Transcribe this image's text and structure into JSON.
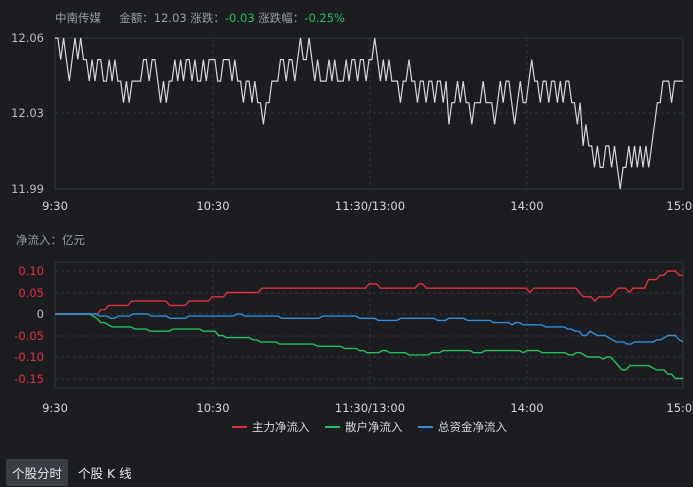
{
  "header": {
    "stock_name": "中南传媒",
    "amount_label": "金额：",
    "amount_value": "12.03",
    "change_label": "涨跌：",
    "change_value": "-0.03",
    "change_pct_label": "涨跌幅：",
    "change_pct_value": "-0.25%"
  },
  "colors": {
    "background": "#1b1d21",
    "price_line": "#d5d7da",
    "main_flow": "#e2313c",
    "retail_flow": "#21c25e",
    "total_flow": "#2f8fdc",
    "positive_tick": "#e2313c",
    "negative_tick": "#e2313c",
    "grid": "#33363c"
  },
  "unit_label": "净流入：亿元",
  "chart_data": [
    {
      "type": "line",
      "title": "",
      "x_ticks": [
        "9:30",
        "10:30",
        "11:30/13:00",
        "14:00",
        "15:00"
      ],
      "y_ticks": [
        "12.06",
        "12.03",
        "11.99"
      ],
      "ylim": [
        11.99,
        12.06
      ],
      "series": [
        {
          "values": [
            12.06,
            12.06,
            12.05,
            12.06,
            12.05,
            12.04,
            12.05,
            12.06,
            12.05,
            12.06,
            12.05,
            12.05,
            12.04,
            12.05,
            12.04,
            12.05,
            12.05,
            12.04,
            12.04,
            12.05,
            12.04,
            12.05,
            12.04,
            12.04,
            12.03,
            12.04,
            12.03,
            12.04,
            12.04,
            12.04,
            12.04,
            12.05,
            12.05,
            12.04,
            12.05,
            12.05,
            12.04,
            12.03,
            12.04,
            12.03,
            12.04,
            12.04,
            12.05,
            12.04,
            12.05,
            12.04,
            12.05,
            12.05,
            12.04,
            12.05,
            12.04,
            12.04,
            12.05,
            12.04,
            12.05,
            12.05,
            12.05,
            12.04,
            12.04,
            12.05,
            12.05,
            12.05,
            12.04,
            12.05,
            12.04,
            12.04,
            12.03,
            12.04,
            12.04,
            12.03,
            12.04,
            12.03,
            12.03,
            12.02,
            12.03,
            12.03,
            12.04,
            12.04,
            12.04,
            12.05,
            12.05,
            12.04,
            12.05,
            12.05,
            12.04,
            12.05,
            12.06,
            12.05,
            12.05,
            12.06,
            12.05,
            12.04,
            12.05,
            12.04,
            12.04,
            12.04,
            12.05,
            12.04,
            12.05,
            12.04,
            12.04,
            12.04,
            12.05,
            12.04,
            12.05,
            12.05,
            12.04,
            12.05,
            12.05,
            12.04,
            12.05,
            12.05,
            12.06,
            12.05,
            12.04,
            12.05,
            12.04,
            12.05,
            12.04,
            12.04,
            12.04,
            12.03,
            12.04,
            12.04,
            12.05,
            12.04,
            12.04,
            12.03,
            12.04,
            12.04,
            12.03,
            12.04,
            12.04,
            12.03,
            12.04,
            12.04,
            12.03,
            12.04,
            12.02,
            12.03,
            12.03,
            12.04,
            12.03,
            12.04,
            12.03,
            12.03,
            12.02,
            12.03,
            12.03,
            12.03,
            12.04,
            12.03,
            12.03,
            12.03,
            12.02,
            12.03,
            12.04,
            12.03,
            12.04,
            12.04,
            12.03,
            12.02,
            12.03,
            12.04,
            12.03,
            12.03,
            12.04,
            12.05,
            12.04,
            12.04,
            12.03,
            12.04,
            12.04,
            12.03,
            12.04,
            12.04,
            12.03,
            12.04,
            12.03,
            12.04,
            12.04,
            12.03,
            12.03,
            12.02,
            12.03,
            12.01,
            12.02,
            12.01,
            12.01,
            12.0,
            12.01,
            12.0,
            12.0,
            12.01,
            12.01,
            12.0,
            12.01,
            12.0,
            11.99,
            12.0,
            12.0,
            12.01,
            12.0,
            12.01,
            12.0,
            12.01,
            12.0,
            12.01,
            12.0,
            12.01,
            12.02,
            12.03,
            12.03,
            12.04,
            12.04,
            12.04,
            12.03,
            12.04,
            12.04,
            12.04,
            12.04
          ]
        }
      ]
    },
    {
      "type": "line",
      "title": "",
      "x_ticks": [
        "9:30",
        "10:30",
        "11:30/13:00",
        "14:00",
        "15:00"
      ],
      "y_ticks": [
        "0.10",
        "0.05",
        "0",
        "-0.05",
        "-0.10",
        "-0.15"
      ],
      "ylim": [
        -0.15,
        0.1
      ],
      "series": [
        {
          "name": "主力净流入",
          "values": [
            0,
            0,
            0,
            0,
            0,
            0,
            0,
            0,
            0,
            0,
            0,
            0,
            0.01,
            0.01,
            0.02,
            0.02,
            0.02,
            0.02,
            0.02,
            0.02,
            0.03,
            0.03,
            0.03,
            0.03,
            0.03,
            0.03,
            0.03,
            0.03,
            0.03,
            0.03,
            0.02,
            0.02,
            0.02,
            0.02,
            0.02,
            0.03,
            0.03,
            0.03,
            0.03,
            0.03,
            0.03,
            0.04,
            0.04,
            0.04,
            0.04,
            0.05,
            0.05,
            0.05,
            0.05,
            0.05,
            0.05,
            0.05,
            0.05,
            0.05,
            0.06,
            0.06,
            0.06,
            0.06,
            0.06,
            0.06,
            0.06,
            0.06,
            0.06,
            0.06,
            0.06,
            0.06,
            0.06,
            0.06,
            0.06,
            0.06,
            0.06,
            0.06,
            0.06,
            0.06,
            0.06,
            0.06,
            0.06,
            0.06,
            0.06,
            0.06,
            0.06,
            0.06,
            0.07,
            0.07,
            0.07,
            0.06,
            0.06,
            0.06,
            0.06,
            0.06,
            0.06,
            0.06,
            0.06,
            0.06,
            0.06,
            0.07,
            0.07,
            0.06,
            0.06,
            0.06,
            0.06,
            0.06,
            0.06,
            0.06,
            0.06,
            0.06,
            0.06,
            0.06,
            0.06,
            0.06,
            0.06,
            0.06,
            0.06,
            0.06,
            0.06,
            0.06,
            0.06,
            0.06,
            0.06,
            0.06,
            0.06,
            0.06,
            0.06,
            0.06,
            0.05,
            0.06,
            0.06,
            0.06,
            0.06,
            0.06,
            0.06,
            0.06,
            0.06,
            0.06,
            0.06,
            0.06,
            0.06,
            0.05,
            0.04,
            0.04,
            0.04,
            0.03,
            0.04,
            0.04,
            0.04,
            0.04,
            0.05,
            0.06,
            0.06,
            0.06,
            0.05,
            0.06,
            0.06,
            0.06,
            0.06,
            0.08,
            0.08,
            0.08,
            0.09,
            0.09,
            0.1,
            0.1,
            0.1,
            0.09,
            0.09
          ]
        },
        {
          "name": "散户净流入",
          "values": [
            0,
            0,
            0,
            0,
            0,
            0,
            0,
            0,
            0,
            0,
            -0.005,
            -0.01,
            -0.02,
            -0.02,
            -0.025,
            -0.03,
            -0.03,
            -0.03,
            -0.03,
            -0.03,
            -0.03,
            -0.035,
            -0.035,
            -0.035,
            -0.035,
            -0.04,
            -0.04,
            -0.04,
            -0.04,
            -0.04,
            -0.04,
            -0.035,
            -0.035,
            -0.035,
            -0.035,
            -0.035,
            -0.035,
            -0.035,
            -0.035,
            -0.04,
            -0.04,
            -0.04,
            -0.04,
            -0.05,
            -0.05,
            -0.055,
            -0.055,
            -0.055,
            -0.055,
            -0.055,
            -0.055,
            -0.055,
            -0.06,
            -0.06,
            -0.065,
            -0.065,
            -0.065,
            -0.065,
            -0.065,
            -0.07,
            -0.07,
            -0.07,
            -0.07,
            -0.07,
            -0.07,
            -0.07,
            -0.07,
            -0.07,
            -0.07,
            -0.075,
            -0.075,
            -0.075,
            -0.075,
            -0.075,
            -0.075,
            -0.075,
            -0.08,
            -0.08,
            -0.08,
            -0.08,
            -0.085,
            -0.085,
            -0.09,
            -0.09,
            -0.09,
            -0.09,
            -0.085,
            -0.085,
            -0.09,
            -0.09,
            -0.09,
            -0.09,
            -0.09,
            -0.095,
            -0.095,
            -0.095,
            -0.095,
            -0.095,
            -0.095,
            -0.09,
            -0.09,
            -0.09,
            -0.085,
            -0.085,
            -0.085,
            -0.085,
            -0.085,
            -0.085,
            -0.085,
            -0.085,
            -0.09,
            -0.09,
            -0.09,
            -0.085,
            -0.085,
            -0.085,
            -0.085,
            -0.085,
            -0.085,
            -0.085,
            -0.085,
            -0.085,
            -0.085,
            -0.09,
            -0.085,
            -0.085,
            -0.085,
            -0.085,
            -0.09,
            -0.09,
            -0.09,
            -0.09,
            -0.09,
            -0.09,
            -0.09,
            -0.095,
            -0.095,
            -0.09,
            -0.09,
            -0.095,
            -0.1,
            -0.1,
            -0.1,
            -0.1,
            -0.105,
            -0.1,
            -0.1,
            -0.11,
            -0.12,
            -0.13,
            -0.13,
            -0.12,
            -0.12,
            -0.12,
            -0.12,
            -0.12,
            -0.12,
            -0.125,
            -0.13,
            -0.13,
            -0.13,
            -0.14,
            -0.14,
            -0.15,
            -0.15,
            -0.15
          ]
        },
        {
          "name": "总资金净流入",
          "values": [
            0,
            0,
            0,
            0,
            0,
            0,
            0,
            0,
            0,
            0,
            0,
            0,
            -0.005,
            -0.005,
            -0.005,
            -0.01,
            -0.01,
            -0.005,
            -0.005,
            -0.005,
            -0.005,
            0,
            0,
            0,
            0,
            0,
            -0.005,
            -0.005,
            -0.005,
            -0.005,
            -0.005,
            -0.01,
            -0.01,
            -0.01,
            -0.01,
            -0.01,
            -0.005,
            -0.005,
            -0.005,
            -0.005,
            -0.005,
            -0.005,
            -0.005,
            -0.005,
            -0.005,
            -0.005,
            -0.005,
            -0.005,
            -0.005,
            0,
            0,
            -0.005,
            -0.005,
            -0.005,
            -0.005,
            -0.005,
            -0.005,
            -0.005,
            -0.005,
            -0.005,
            -0.005,
            -0.01,
            -0.01,
            -0.01,
            -0.01,
            -0.01,
            -0.01,
            -0.01,
            -0.01,
            -0.01,
            -0.01,
            -0.01,
            -0.005,
            -0.005,
            -0.005,
            -0.005,
            -0.005,
            -0.005,
            -0.005,
            -0.005,
            -0.005,
            -0.005,
            -0.01,
            -0.01,
            -0.01,
            -0.01,
            -0.01,
            -0.015,
            -0.015,
            -0.015,
            -0.015,
            -0.015,
            -0.015,
            -0.01,
            -0.01,
            -0.01,
            -0.01,
            -0.01,
            -0.01,
            -0.01,
            -0.01,
            -0.01,
            -0.01,
            -0.015,
            -0.015,
            -0.015,
            -0.01,
            -0.01,
            -0.01,
            -0.01,
            -0.01,
            -0.015,
            -0.015,
            -0.015,
            -0.015,
            -0.015,
            -0.015,
            -0.015,
            -0.02,
            -0.02,
            -0.02,
            -0.02,
            -0.02,
            -0.025,
            -0.02,
            -0.02,
            -0.025,
            -0.025,
            -0.025,
            -0.025,
            -0.025,
            -0.025,
            -0.03,
            -0.03,
            -0.03,
            -0.03,
            -0.03,
            -0.03,
            -0.035,
            -0.035,
            -0.04,
            -0.04,
            -0.05,
            -0.05,
            -0.04,
            -0.045,
            -0.05,
            -0.05,
            -0.05,
            -0.055,
            -0.06,
            -0.065,
            -0.065,
            -0.065,
            -0.07,
            -0.07,
            -0.065,
            -0.065,
            -0.065,
            -0.065,
            -0.065,
            -0.065,
            -0.06,
            -0.06,
            -0.055,
            -0.05,
            -0.05,
            -0.05,
            -0.06,
            -0.065
          ]
        }
      ],
      "legend": "bottom-center"
    }
  ],
  "tabs": [
    {
      "label": "个股分时",
      "active": true
    },
    {
      "label": "个股 K 线",
      "active": false
    }
  ]
}
